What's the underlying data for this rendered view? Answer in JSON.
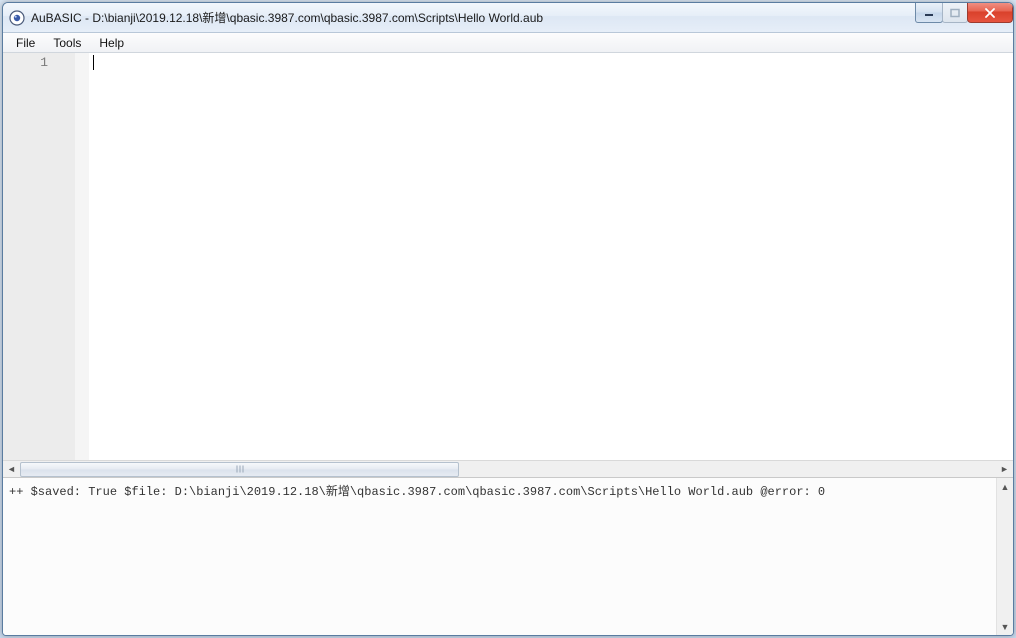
{
  "titlebar": {
    "title": "AuBASIC - D:\\bianji\\2019.12.18\\新增\\qbasic.3987.com\\qbasic.3987.com\\Scripts\\Hello World.aub"
  },
  "menu": {
    "file": "File",
    "tools": "Tools",
    "help": "Help"
  },
  "editor": {
    "line_number": "1",
    "content": ""
  },
  "console": {
    "output": "++ $saved: True $file: D:\\bianji\\2019.12.18\\新增\\qbasic.3987.com\\qbasic.3987.com\\Scripts\\Hello World.aub @error: 0"
  }
}
